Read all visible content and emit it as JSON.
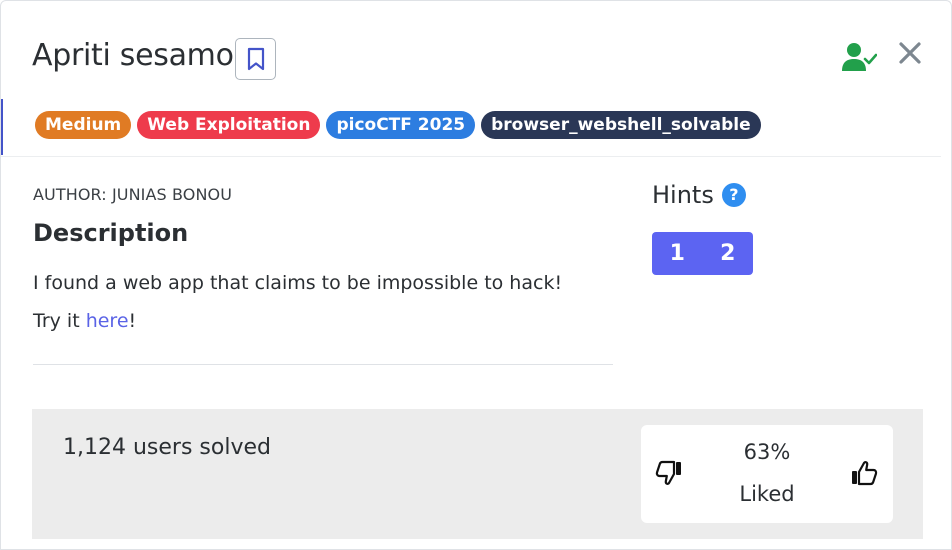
{
  "challenge": {
    "title": "Apriti sesamo",
    "tags": [
      "Medium",
      "Web Exploitation",
      "picoCTF 2025",
      "browser_webshell_solvable"
    ],
    "author": "AUTHOR: JUNIAS BONOU",
    "description_heading": "Description",
    "description_line1": "I found a web app that claims to be impossible to hack!",
    "description_line2_prefix": "Try it ",
    "description_link": "here",
    "description_line2_suffix": "!"
  },
  "hints": {
    "title": "Hints",
    "help_icon": "?",
    "buttons": [
      "1",
      "2"
    ]
  },
  "stats": {
    "solved": "1,124 users solved",
    "liked_percent": "63%",
    "liked_label": "Liked"
  },
  "icons": {
    "bookmark": "bookmark-icon",
    "user_check": "user-check-icon",
    "close": "close-icon",
    "thumb_down": "thumbs-down-icon",
    "thumb_up": "thumbs-up-icon"
  },
  "colors": {
    "tag_medium": "#e07b24",
    "tag_web": "#ee3b4c",
    "tag_pico": "#2d7de0",
    "tag_browser": "#2a3756",
    "hints_button": "#5c64f2",
    "link": "#5a63e6",
    "user_check": "#22a04b"
  }
}
